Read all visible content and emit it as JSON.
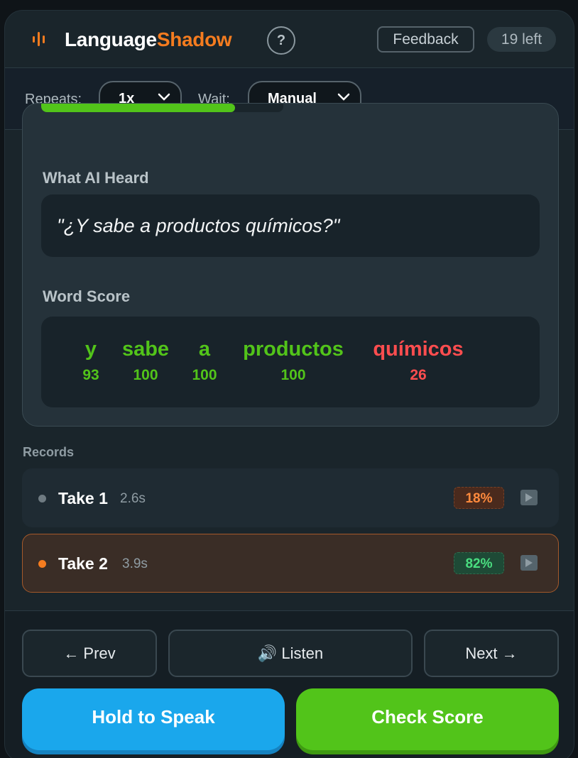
{
  "header": {
    "brand_part1": "Language",
    "brand_part2": "Shadow",
    "help_label": "?",
    "feedback_label": "Feedback",
    "remaining_label": "19 left"
  },
  "settings": {
    "repeats_label": "Repeats:",
    "repeats_value": "1x",
    "wait_label": "Wait:",
    "wait_value": "Manual"
  },
  "progress": {
    "fraction": 0.8
  },
  "heard": {
    "title": "What AI Heard",
    "text": "\"¿Y sabe a productos químicos?\""
  },
  "word_score": {
    "title": "Word Score",
    "words": [
      {
        "word": "y",
        "score": "93",
        "status": "good"
      },
      {
        "word": "sabe",
        "score": "100",
        "status": "good"
      },
      {
        "word": "a",
        "score": "100",
        "status": "good"
      },
      {
        "word": "productos",
        "score": "100",
        "status": "good"
      },
      {
        "word": "químicos",
        "score": "26",
        "status": "bad"
      }
    ]
  },
  "records": {
    "title": "Records",
    "takes": [
      {
        "name": "Take 1",
        "duration": "2.6s",
        "score": "18%",
        "active": false
      },
      {
        "name": "Take 2",
        "duration": "3.9s",
        "score": "82%",
        "active": true
      }
    ]
  },
  "nav": {
    "prev_label": "← Prev",
    "listen_label": "🔊 Listen",
    "next_label": "Next →",
    "speak_label": "Hold to Speak",
    "check_label": "Check Score"
  },
  "colors": {
    "brand_accent": "#f57c1f",
    "good": "#52c41a",
    "bad": "#ff4d4f",
    "speak_button": "#1aa7ec",
    "check_button": "#52c41a"
  }
}
